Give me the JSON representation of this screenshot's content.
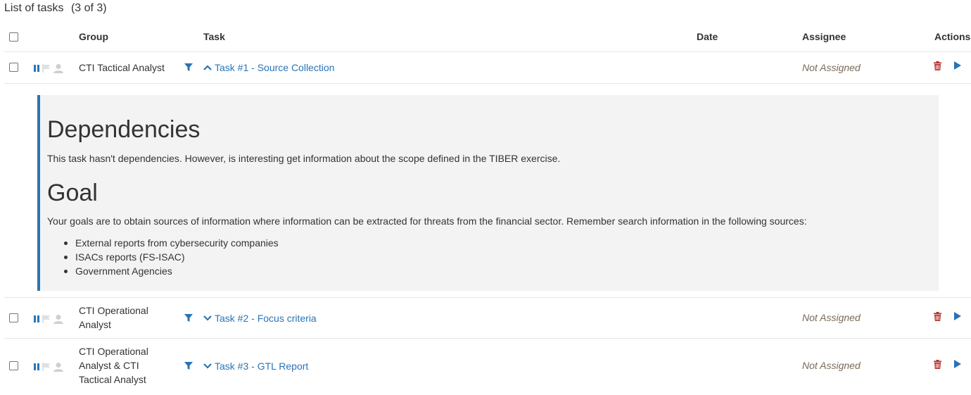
{
  "list": {
    "title": "List of tasks",
    "count": "(3 of 3)"
  },
  "headers": {
    "group": "Group",
    "task": "Task",
    "date": "Date",
    "assignee": "Assignee",
    "actions": "Actions"
  },
  "rows": [
    {
      "group_lines": [
        "CTI Tactical Analyst"
      ],
      "task": "Task #1 - Source Collection",
      "expanded": true,
      "date": "",
      "assignee": "Not Assigned"
    },
    {
      "group_lines": [
        "CTI Operational",
        "Analyst"
      ],
      "task": "Task #2 - Focus criteria",
      "expanded": false,
      "date": "",
      "assignee": "Not Assigned"
    },
    {
      "group_lines": [
        "CTI Operational",
        "Analyst & CTI",
        "Tactical Analyst"
      ],
      "task": "Task #3 - GTL Report",
      "expanded": false,
      "date": "",
      "assignee": "Not Assigned"
    }
  ],
  "detail": {
    "dependencies_heading": "Dependencies",
    "dependencies_text": "This task hasn't dependencies. However, is interesting get information about the scope defined in the TIBER exercise.",
    "goal_heading": "Goal",
    "goal_text": "Your goals are to obtain sources of information where information can be extracted for threats from the financial sector. Remember search information in the following sources:",
    "sources": [
      "External reports from cybersecurity companies",
      "ISACs reports (FS-ISAC)",
      "Government Agencies"
    ]
  },
  "colors": {
    "link": "#2a74b5",
    "trash": "#b5322b",
    "assignee": "#7a6a56",
    "detail_bg": "#f3f3f3"
  }
}
